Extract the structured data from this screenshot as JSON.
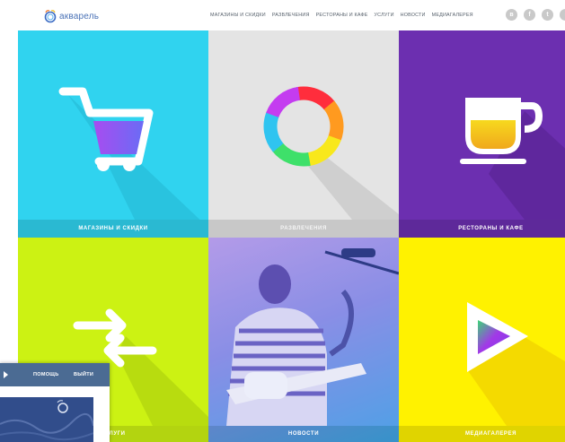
{
  "header": {
    "logo_text": "акварель",
    "nav": [
      "магазины и скидки",
      "развлечения",
      "рестораны и кафе",
      "услуги",
      "новости",
      "медиагалерея"
    ],
    "social": [
      "в",
      "f",
      "t",
      "i"
    ]
  },
  "tiles": [
    {
      "label": "магазины и скидки",
      "color": "#30d3ef",
      "icon": "shopping-cart-icon"
    },
    {
      "label": "развлечения",
      "color": "#e4e4e4",
      "icon": "rainbow-ring-icon"
    },
    {
      "label": "рестораны и кафе",
      "color": "#6c2fb0",
      "icon": "coffee-cup-icon"
    },
    {
      "label": "услуги",
      "color": "#ccf213",
      "icon": "exchange-arrows-icon"
    },
    {
      "label": "новости",
      "color": "#8e8ee6",
      "icon": "guitarist-photo"
    },
    {
      "label": "медиагалерея",
      "color": "#fff200",
      "icon": "play-icon"
    }
  ],
  "popup": {
    "help_label": "помощь",
    "exit_label": "выйти",
    "bar_color": "#4b6b93"
  }
}
